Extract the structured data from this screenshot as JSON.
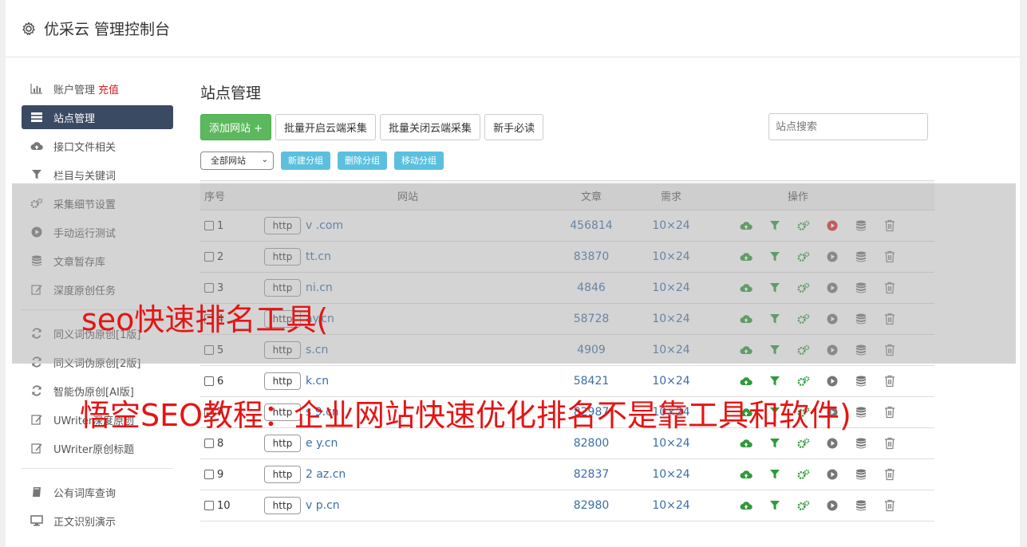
{
  "header": {
    "title": "优采云 管理控制台"
  },
  "sidebar": {
    "items": [
      {
        "label": "账户管理",
        "icon": "bar-chart-icon",
        "extra": "充值"
      },
      {
        "label": "站点管理",
        "icon": "list-icon"
      },
      {
        "label": "接口文件相关",
        "icon": "cloud-upload-icon"
      },
      {
        "label": "栏目与关键词",
        "icon": "filter-icon"
      },
      {
        "label": "采集细节设置",
        "icon": "cogs-icon"
      },
      {
        "label": "手动运行测试",
        "icon": "play-circle-icon"
      },
      {
        "label": "文章暂存库",
        "icon": "database-icon"
      },
      {
        "label": "深度原创任务",
        "icon": "edit-icon"
      }
    ],
    "items2": [
      {
        "label": "同义词伪原创[1版]",
        "icon": "refresh-icon"
      },
      {
        "label": "同义词伪原创[2版]",
        "icon": "refresh-icon"
      },
      {
        "label": "智能伪原创[AI版]",
        "icon": "refresh-icon"
      },
      {
        "label": "UWriter深度原创",
        "icon": "edit-icon"
      },
      {
        "label": "UWriter原创标题",
        "icon": "edit-icon"
      }
    ],
    "items3": [
      {
        "label": "公有词库查询",
        "icon": "book-icon"
      },
      {
        "label": "正文识别演示",
        "icon": "monitor-icon"
      }
    ]
  },
  "main": {
    "title": "站点管理",
    "toolbar": {
      "add": "添加网站 +",
      "batch_open": "批量开启云端采集",
      "batch_close": "批量关闭云端采集",
      "newbie": "新手必读",
      "search_placeholder": "站点搜索"
    },
    "group": {
      "select": "全部网站",
      "new": "新建分组",
      "delete": "删除分组",
      "move": "移动分组"
    },
    "table": {
      "headers": {
        "no": "序号",
        "site": "网站",
        "articles": "文章",
        "demand": "需求",
        "ops": "操作"
      },
      "rows": [
        {
          "no": "1",
          "proto": "http",
          "site": "v        .com",
          "articles": "456814",
          "demand": "10×24",
          "active": true
        },
        {
          "no": "2",
          "proto": "http",
          "site": "    tt.cn",
          "articles": "83870",
          "demand": "10×24",
          "active": false
        },
        {
          "no": "3",
          "proto": "http",
          "site": "     ni.cn",
          "articles": "4846",
          "demand": "10×24",
          "active": false
        },
        {
          "no": "4",
          "proto": "http",
          "site": "    ay.cn",
          "articles": "58728",
          "demand": "10×24",
          "active": false
        },
        {
          "no": "5",
          "proto": "http",
          "site": "     s.cn",
          "articles": "4909",
          "demand": "10×24",
          "active": false
        },
        {
          "no": "6",
          "proto": "http",
          "site": "    k.cn",
          "articles": "58421",
          "demand": "10×24",
          "active": false
        },
        {
          "no": "7",
          "proto": "http",
          "site": "s  9.cn",
          "articles": "82987",
          "demand": "10×24",
          "active": false
        },
        {
          "no": "8",
          "proto": "http",
          "site": "e    y.cn",
          "articles": "82800",
          "demand": "10×24",
          "active": false
        },
        {
          "no": "9",
          "proto": "http",
          "site": "2   az.cn",
          "articles": "82837",
          "demand": "10×24",
          "active": false
        },
        {
          "no": "10",
          "proto": "http",
          "site": "v   p.cn",
          "articles": "82980",
          "demand": "10×24",
          "active": false
        }
      ]
    }
  },
  "overlay": {
    "line1": "seo快速排名工具(",
    "line2": "悟空SEO教程：企业网站快速优化排名不是靠工具和软件)"
  },
  "colors": {
    "green": "#5cb85c",
    "accent": "#5bc0de",
    "nav_active": "#3b4a63",
    "overlay_text": "#e61414",
    "link": "#3b6ea8"
  }
}
